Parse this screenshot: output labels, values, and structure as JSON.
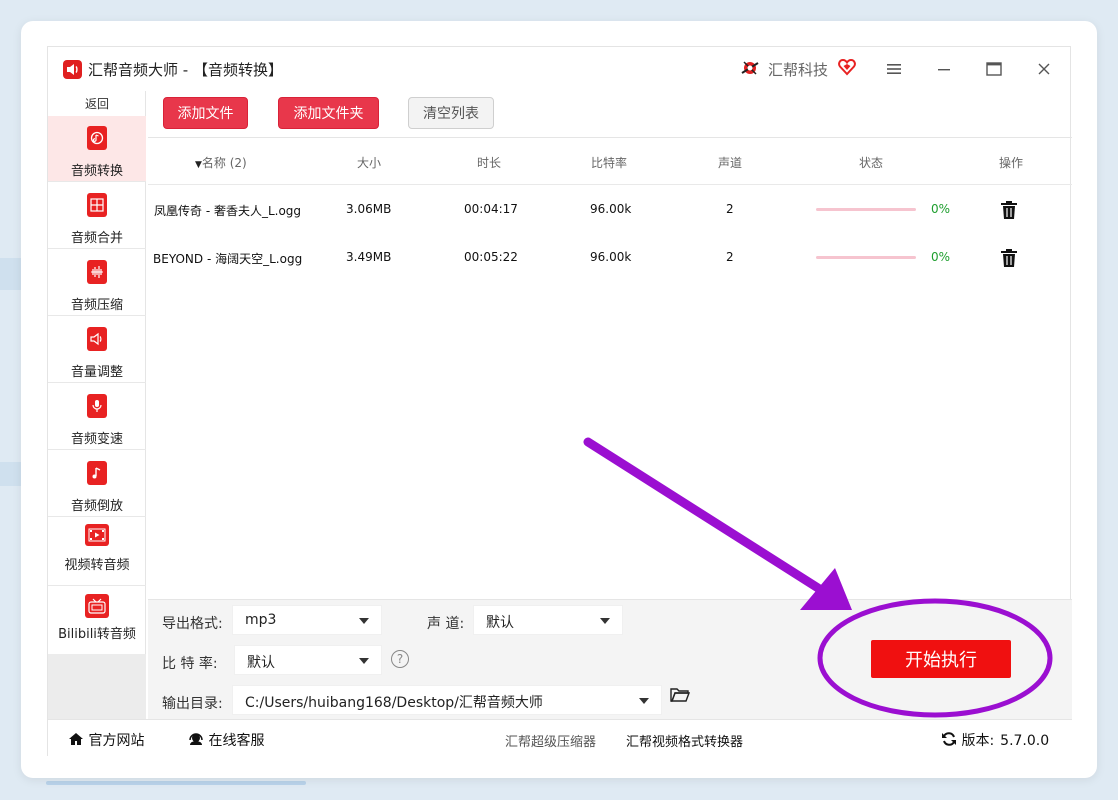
{
  "window": {
    "app_name": "汇帮音频大师",
    "title_suffix": " - 【音频转换】",
    "brand": "汇帮科技"
  },
  "sidebar": {
    "back": "返回",
    "items": [
      {
        "label": "音频转换",
        "icon": "audio-convert-icon",
        "active": true
      },
      {
        "label": "音频合并",
        "icon": "audio-merge-icon"
      },
      {
        "label": "音频压缩",
        "icon": "audio-compress-icon"
      },
      {
        "label": "音量调整",
        "icon": "volume-icon"
      },
      {
        "label": "音频变速",
        "icon": "microphone-icon"
      },
      {
        "label": "音频倒放",
        "icon": "music-note-icon"
      },
      {
        "label": "视频转音频",
        "icon": "film-icon"
      },
      {
        "label": "Bilibili转音频",
        "icon": "tv-icon"
      }
    ]
  },
  "toolbar": {
    "add_file": "添加文件",
    "add_folder": "添加文件夹",
    "clear_list": "清空列表"
  },
  "table": {
    "headers": {
      "name": "名称 (2)",
      "size": "大小",
      "duration": "时长",
      "bitrate": "比特率",
      "channels": "声道",
      "status": "状态",
      "actions": "操作"
    },
    "rows": [
      {
        "name": "凤凰传奇 - 奢香夫人_L.ogg",
        "size": "3.06MB",
        "duration": "00:04:17",
        "bitrate": "96.00k",
        "channels": "2",
        "progress": "0%"
      },
      {
        "name": "BEYOND - 海阔天空_L.ogg",
        "size": "3.49MB",
        "duration": "00:05:22",
        "bitrate": "96.00k",
        "channels": "2",
        "progress": "0%"
      }
    ]
  },
  "settings": {
    "format_label": "导出格式:",
    "format_value": "mp3",
    "channel_label": "声 道:",
    "channel_value": "默认",
    "bitrate_label": "比 特 率:",
    "bitrate_value": "默认",
    "help": "?",
    "output_label": "输出目录:",
    "output_value": "C:/Users/huibang168/Desktop/汇帮音频大师",
    "start": "开始执行"
  },
  "footer": {
    "website": "官方网站",
    "support": "在线客服",
    "link1": "汇帮超级压缩器",
    "link2": "汇帮视频格式转换器",
    "version_label": "版本:",
    "version": "5.7.0.0"
  },
  "colors": {
    "accent": "#e8374b",
    "start_button": "#f01010",
    "annotation": "#9b0fd1",
    "progress_text": "#1e9e2e"
  }
}
